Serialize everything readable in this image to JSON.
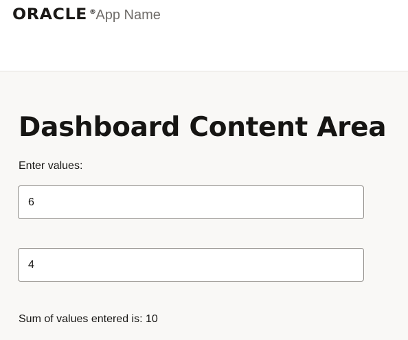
{
  "header": {
    "logo_text": "ORACLE",
    "logo_mark": "®",
    "app_name": "App Name"
  },
  "main": {
    "title": "Dashboard Content Area",
    "instructions": "Enter values:",
    "inputs": [
      {
        "value": "6"
      },
      {
        "value": "4"
      }
    ],
    "sum_label": "Sum of values entered is:",
    "sum_value": "10"
  },
  "colors": {
    "background": "#f9f8f6",
    "header_background": "#ffffff",
    "text": "#161513",
    "app_name_text": "#6f6c69",
    "input_border": "#8f8c88"
  }
}
